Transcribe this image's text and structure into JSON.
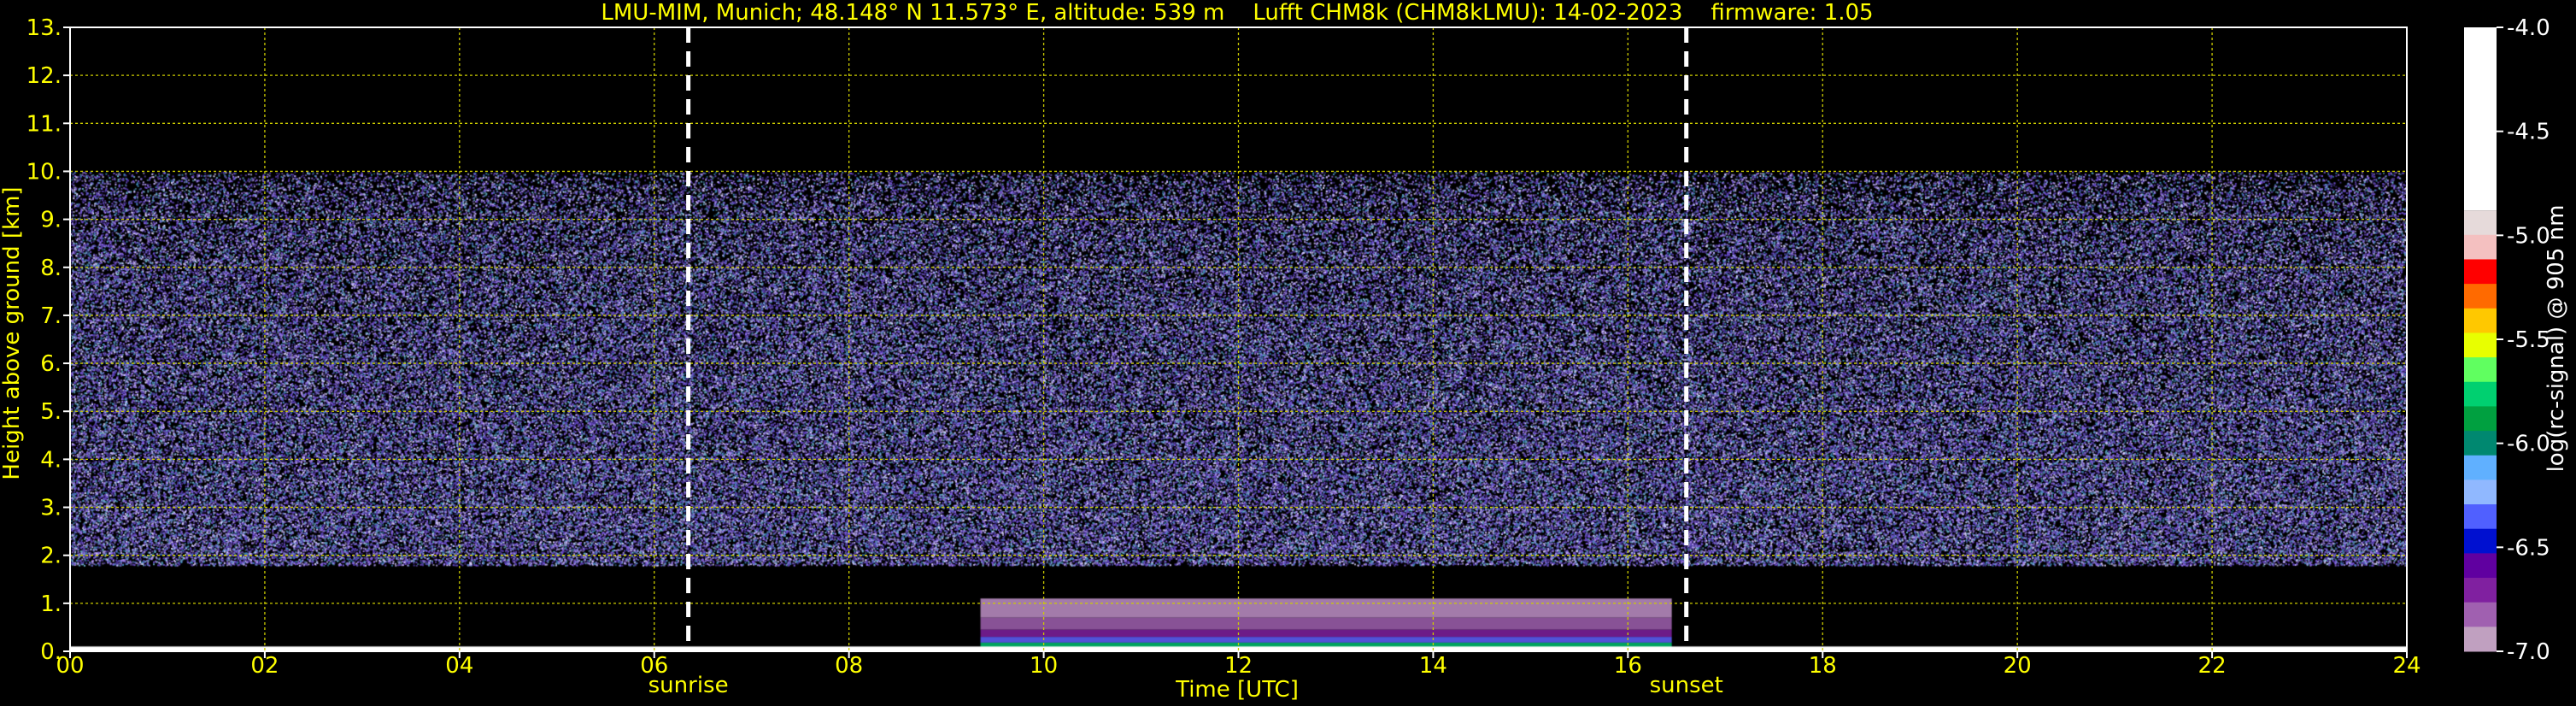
{
  "chart_data": {
    "type": "heatmap",
    "title": "LMU-MIM, Munich; 48.148° N 11.573° E, altitude: 539 m    Lufft CHM8k (CHM8kLMU): 14-02-2023    firmware: 1.05",
    "xlabel": "Time [UTC]",
    "ylabel": "Height above ground [km]",
    "xlim": [
      0,
      24
    ],
    "ylim": [
      0,
      13
    ],
    "x_ticks": [
      "00",
      "02",
      "04",
      "06",
      "08",
      "10",
      "12",
      "14",
      "16",
      "18",
      "20",
      "22",
      "24"
    ],
    "x_tick_values": [
      0,
      2,
      4,
      6,
      8,
      10,
      12,
      14,
      16,
      18,
      20,
      22,
      24
    ],
    "y_ticks": [
      "0.",
      "1.",
      "2.",
      "3.",
      "4.",
      "5.",
      "6.",
      "7.",
      "8.",
      "9.",
      "10.",
      "11.",
      "12.",
      "13."
    ],
    "y_tick_values": [
      0,
      1,
      2,
      3,
      4,
      5,
      6,
      7,
      8,
      9,
      10,
      11,
      12,
      13
    ],
    "grid": true,
    "signal_max_height_km": 10,
    "sun_events": [
      {
        "label": "sunrise",
        "time": 6.35
      },
      {
        "label": "sunset",
        "time": 16.6
      }
    ],
    "boundary_layer": {
      "start": 9.35,
      "end": 16.45,
      "top_km": 1.1
    },
    "colorbar": {
      "label": "log(rc-signal) @ 905 nm",
      "min": -7.0,
      "max": -4.0,
      "ticks": [
        "-4.0",
        "-4.5",
        "-5.0",
        "-5.5",
        "-6.0",
        "-6.5",
        "-7.0"
      ],
      "tick_values": [
        -4.0,
        -4.5,
        -5.0,
        -5.5,
        -6.0,
        -6.5,
        -7.0
      ],
      "colors": [
        "#ffffff",
        "#e6dada",
        "#f4c0c0",
        "#ff0000",
        "#ff6a00",
        "#ffc800",
        "#e8ff00",
        "#60ff60",
        "#00d070",
        "#00a040",
        "#008870",
        "#60b0ff",
        "#90b8ff",
        "#5060ff",
        "#0010d0",
        "#6000a0",
        "#8020a0",
        "#a060b0",
        "#c0a0c0"
      ]
    }
  },
  "colors": {
    "text": "#ffff00",
    "grid": "#cccc00",
    "background": "#000000",
    "marker_line": "#ffffff"
  }
}
